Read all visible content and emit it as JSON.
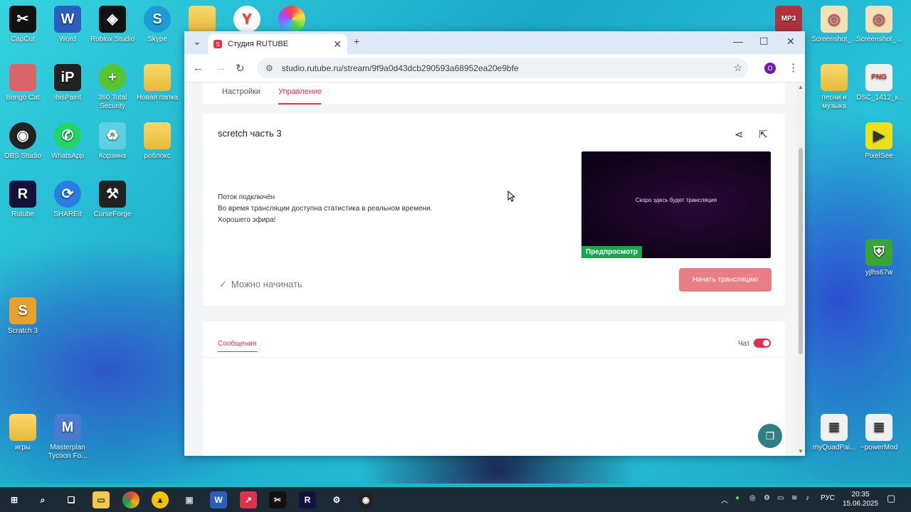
{
  "desktop": {
    "left_icons": [
      {
        "label": "CapCut"
      },
      {
        "label": "Word"
      },
      {
        "label": "Roblox Studio"
      },
      {
        "label": "Skype"
      },
      {
        "label": "Bongo Cat"
      },
      {
        "label": "ibisPaint"
      },
      {
        "label": "360 Total Security"
      },
      {
        "label": "Новая папка"
      },
      {
        "label": "OBS Studio"
      },
      {
        "label": "WhatsApp"
      },
      {
        "label": "Корзина"
      },
      {
        "label": "роблокс"
      },
      {
        "label": "Rutube"
      },
      {
        "label": "SHAREit"
      },
      {
        "label": "CurseForge"
      },
      {
        "label": "Scratch 3"
      },
      {
        "label": "игры"
      },
      {
        "label": "Masterplan Tycoon Fo..."
      }
    ],
    "right_icons": [
      {
        "label": "MP3"
      },
      {
        "label": "Screenshot_..."
      },
      {
        "label": "Screenshot_..."
      },
      {
        "label": "песни и музыка"
      },
      {
        "label": "DSC_1412_к..."
      },
      {
        "label": "PixelSee"
      },
      {
        "label": "yjlhs67w"
      },
      {
        "label": "myQuadPai..."
      },
      {
        "label": "~powerMod"
      }
    ]
  },
  "browser": {
    "tab_title": "Студия RUTUBE",
    "url": "studio.rutube.ru/stream/9f9a0d43dcb290593a68952ea20e9bfe",
    "profile_initial": "O"
  },
  "page": {
    "subtabs": [
      "Настройки",
      "Управление"
    ],
    "stream_title": "scretch часть 3",
    "status_lines": [
      "Поток подключён",
      "Во время трансляции доступна статистика в реальном времени.",
      "Хорошего эфира!"
    ],
    "preview_text": "Скоро здесь будет трансляция",
    "preview_badge": "Предпросмотр",
    "ready_text": "Можно начинать",
    "start_button": "Начать трансляцию",
    "messages_tab": "Сообщения",
    "chat_label": "Чат",
    "chat_enabled": true
  },
  "taskbar": {
    "language": "РУС",
    "time": "20:35",
    "date": "15.06.2025"
  },
  "colors": {
    "accent": "#e0304b",
    "start_button": "#e87f86",
    "preview_badge": "#13a84a"
  }
}
